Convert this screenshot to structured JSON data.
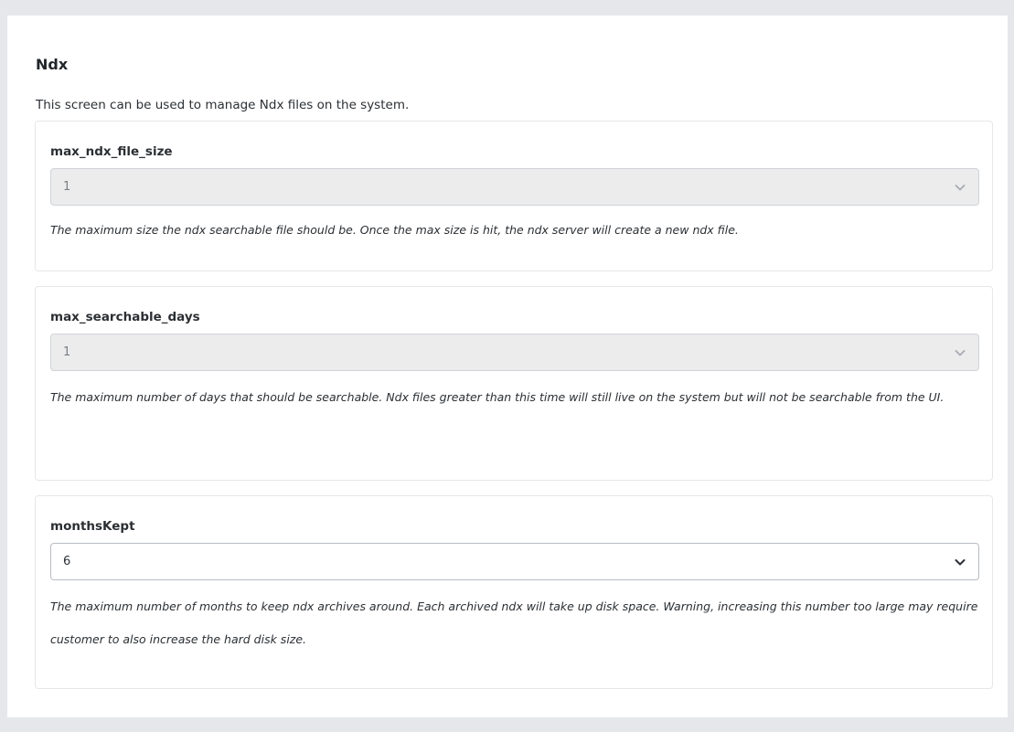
{
  "page": {
    "title": "Ndx",
    "description": "This screen can be used to manage Ndx files on the system."
  },
  "settings": [
    {
      "label": "max_ndx_file_size",
      "value": "1",
      "disabled": true,
      "help": "The maximum size the ndx searchable file should be. Once the max size is hit, the ndx server will create a new ndx file."
    },
    {
      "label": "max_searchable_days",
      "value": "1",
      "disabled": true,
      "help": "The maximum number of days that should be searchable. Ndx files greater than this time will still live on the system but will not be searchable from the UI."
    },
    {
      "label": "monthsKept",
      "value": "6",
      "disabled": false,
      "help": "The maximum number of months to keep ndx archives around. Each archived ndx will take up disk space. Warning, increasing this number too large may require customer to also increase the hard disk size."
    }
  ],
  "icons": {
    "dropdown": "chevron-down-icon"
  },
  "colors": {
    "page_background": "#e6e7ea",
    "panel_background": "#ffffff",
    "disabled_select": "#ececec",
    "text": "#212529"
  }
}
